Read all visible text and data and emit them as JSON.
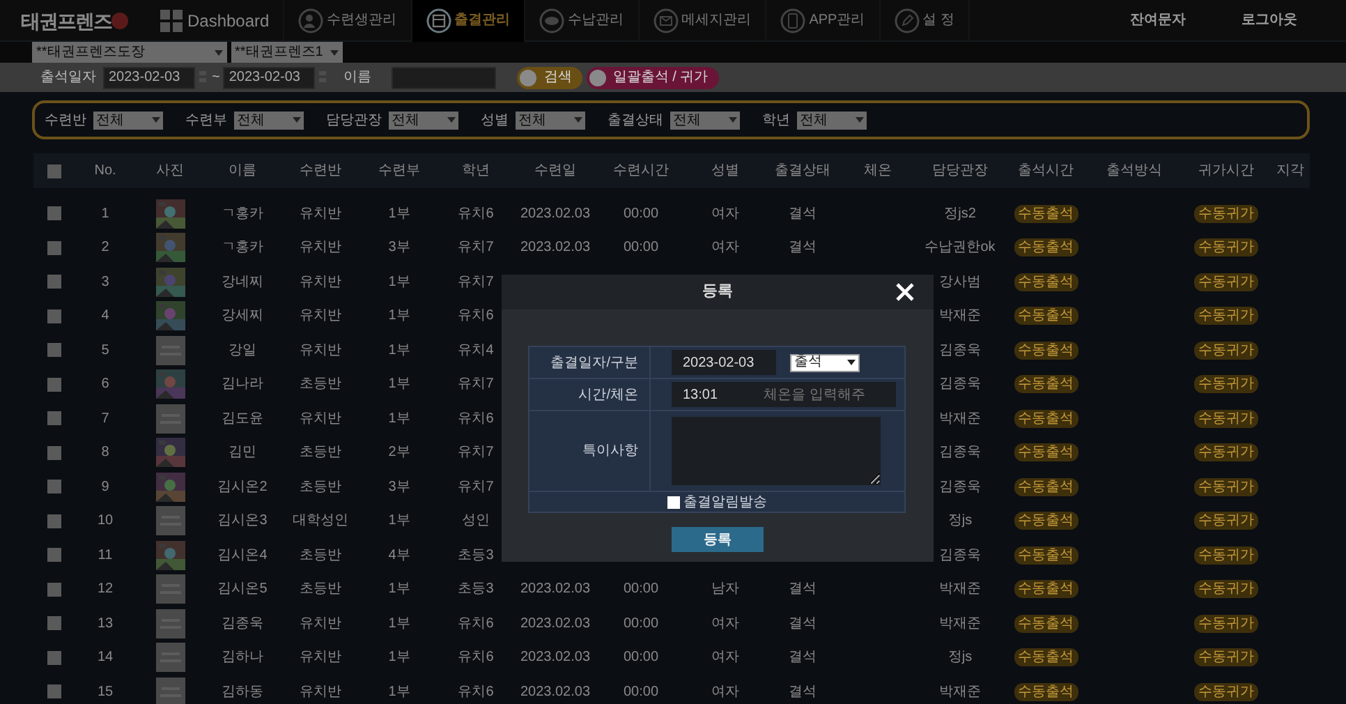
{
  "nav": {
    "logo": "태권프렌즈",
    "items": [
      {
        "label": "Dashboard",
        "selected": false
      },
      {
        "label": "수련생관리",
        "selected": false
      },
      {
        "label": "출결관리",
        "selected": true
      },
      {
        "label": "수납관리",
        "selected": false
      },
      {
        "label": "메세지관리",
        "selected": false
      },
      {
        "label": "APP관리",
        "selected": false
      },
      {
        "label": "설 정",
        "selected": false
      }
    ],
    "links": [
      "잔여문자",
      "로그아웃"
    ]
  },
  "selects": [
    "**태권프렌즈도장",
    "**태권프렌즈1"
  ],
  "search": {
    "date_label": "출석일자",
    "date_from": "2023-02-03",
    "separator": "~",
    "date_to": "2023-02-03",
    "name_label": "이름",
    "buttons": [
      {
        "label": "검색",
        "kind": "search"
      },
      {
        "label": "일괄출석 / 귀가",
        "kind": "bulk"
      }
    ]
  },
  "filters": [
    {
      "label": "수련반",
      "value": "전체"
    },
    {
      "label": "수련부",
      "value": "전체"
    },
    {
      "label": "담당관장",
      "value": "전체"
    },
    {
      "label": "성별",
      "value": "전체"
    },
    {
      "label": "출결상태",
      "value": "전체"
    },
    {
      "label": "학년",
      "value": "전체"
    }
  ],
  "table": {
    "header_checked": false,
    "columns": [
      "No.",
      "사진",
      "이름",
      "수련반",
      "수련부",
      "학년",
      "수련일",
      "수련시간",
      "성별",
      "출결상태",
      "체온",
      "담당관장",
      "출석시간",
      "출석방식",
      "귀가시간",
      "지각"
    ],
    "rows": [
      {
        "checked": false,
        "no": "1",
        "name": "ㄱ홍카",
        "class": "유치반",
        "part": "1부",
        "grade": "유치6",
        "date": "2023.02.03",
        "time": "00:00",
        "gender": "여자",
        "status": "결석",
        "manager": "정js2",
        "checkin": "수동출석",
        "checkout": "수동귀가"
      },
      {
        "checked": false,
        "no": "2",
        "name": "ㄱ홍카",
        "class": "유치반",
        "part": "3부",
        "grade": "유치7",
        "date": "2023.02.03",
        "time": "00:00",
        "gender": "여자",
        "status": "결석",
        "manager": "수납권한ok",
        "checkin": "수동출석",
        "checkout": "수동귀가"
      },
      {
        "checked": false,
        "no": "3",
        "name": "강네찌",
        "class": "유치반",
        "part": "1부",
        "grade": "유치7",
        "manager": "강사범",
        "checkin": "수동출석",
        "checkout": "수동귀가"
      },
      {
        "checked": false,
        "no": "4",
        "name": "강세찌",
        "class": "유치반",
        "part": "1부",
        "grade": "유치6",
        "manager": "박재준",
        "checkin": "수동출석",
        "checkout": "수동귀가"
      },
      {
        "checked": false,
        "no": "5",
        "photo": {
          "kind": "placeholder"
        },
        "name": "강일",
        "class": "유치반",
        "part": "1부",
        "grade": "유치4",
        "manager": "김종욱",
        "checkin": "수동출석",
        "checkout": "수동귀가"
      },
      {
        "checked": false,
        "no": "6",
        "name": "김나라",
        "class": "초등반",
        "part": "1부",
        "grade": "유치7",
        "manager": "김종욱",
        "checkin": "수동출석",
        "checkout": "수동귀가"
      },
      {
        "checked": false,
        "no": "7",
        "photo": {
          "kind": "placeholder"
        },
        "name": "김도윤",
        "class": "유치반",
        "part": "1부",
        "grade": "유치6",
        "manager": "박재준",
        "checkin": "수동출석",
        "checkout": "수동귀가"
      },
      {
        "checked": false,
        "no": "8",
        "name": "김민",
        "class": "초등반",
        "part": "2부",
        "grade": "유치7",
        "manager": "김종욱",
        "checkin": "수동출석",
        "checkout": "수동귀가"
      },
      {
        "checked": false,
        "no": "9",
        "name": "김시온2",
        "class": "초등반",
        "part": "3부",
        "grade": "유치7",
        "manager": "김종욱",
        "checkin": "수동출석",
        "checkout": "수동귀가"
      },
      {
        "checked": false,
        "no": "10",
        "photo": {
          "kind": "placeholder"
        },
        "name": "김시온3",
        "class": "대학성인",
        "part": "1부",
        "grade": "성인",
        "manager": "정js",
        "checkin": "수동출석",
        "checkout": "수동귀가"
      },
      {
        "checked": false,
        "no": "11",
        "name": "김시온4",
        "class": "초등반",
        "part": "4부",
        "grade": "초등3",
        "manager": "김종욱",
        "checkin": "수동출석",
        "checkout": "수동귀가"
      },
      {
        "checked": false,
        "no": "12",
        "photo": {
          "kind": "placeholder"
        },
        "name": "김시온5",
        "class": "초등반",
        "part": "1부",
        "grade": "초등3",
        "date": "2023.02.03",
        "time": "00:00",
        "gender": "남자",
        "status": "결석",
        "manager": "박재준",
        "checkin": "수동출석",
        "checkout": "수동귀가"
      },
      {
        "checked": false,
        "no": "13",
        "photo": {
          "kind": "placeholder"
        },
        "name": "김종욱",
        "class": "유치반",
        "part": "1부",
        "grade": "유치6",
        "date": "2023.02.03",
        "time": "00:00",
        "gender": "여자",
        "status": "결석",
        "manager": "박재준",
        "checkin": "수동출석",
        "checkout": "수동귀가"
      },
      {
        "checked": false,
        "no": "14",
        "photo": {
          "kind": "placeholder"
        },
        "name": "김하나",
        "class": "유치반",
        "part": "1부",
        "grade": "유치6",
        "date": "2023.02.03",
        "time": "00:00",
        "gender": "여자",
        "status": "결석",
        "manager": "정js",
        "checkin": "수동출석",
        "checkout": "수동귀가"
      },
      {
        "checked": false,
        "no": "15",
        "photo": {
          "kind": "placeholder"
        },
        "name": "김하동",
        "class": "유치반",
        "part": "1부",
        "grade": "유치6",
        "date": "2023.02.03",
        "time": "00:00",
        "gender": "여자",
        "status": "결석",
        "manager": "박재준",
        "checkin": "수동출석",
        "checkout": "수동귀가"
      }
    ]
  },
  "modal": {
    "title": "등록",
    "fields": [
      {
        "label": "출결일자/구분",
        "kind": "date_select",
        "value": "2023-02-03",
        "select": "출석"
      },
      {
        "label": "시간/체온",
        "kind": "time_temp",
        "value": "13:01",
        "placeholder": "체온을 입력해주"
      },
      {
        "label": "특이사항",
        "kind": "textarea"
      }
    ],
    "notify": {
      "label": "출결알림발송",
      "checked": false
    },
    "submit": "등록"
  }
}
